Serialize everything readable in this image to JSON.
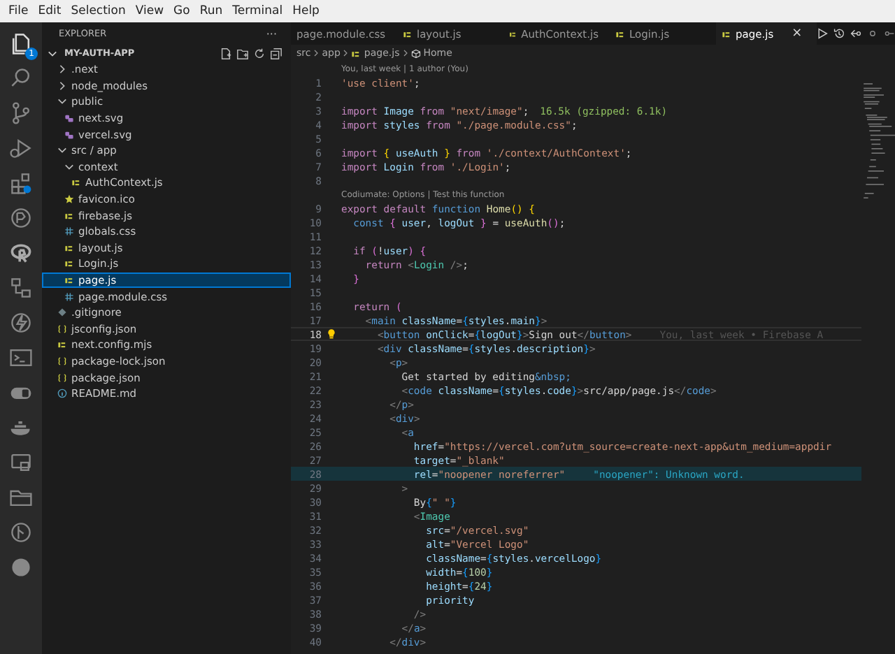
{
  "menu": [
    "File",
    "Edit",
    "Selection",
    "View",
    "Go",
    "Run",
    "Terminal",
    "Help"
  ],
  "activity_bar": {
    "explorer_badge": "1"
  },
  "explorer": {
    "title": "EXPLORER",
    "more": "···",
    "root": {
      "label": "MY-AUTH-APP",
      "expanded": true,
      "children": [
        {
          "label": ".next",
          "kind": "folder",
          "expanded": false,
          "selected": false
        },
        {
          "label": "node_modules",
          "kind": "folder",
          "expanded": false,
          "selected": false
        },
        {
          "label": "public",
          "kind": "folder",
          "expanded": true,
          "selected": false,
          "children": [
            {
              "label": "next.svg",
              "kind": "svg",
              "selected": false
            },
            {
              "label": "vercel.svg",
              "kind": "svg",
              "selected": false
            }
          ]
        },
        {
          "label": "src / app",
          "kind": "folder",
          "expanded": true,
          "selected": false,
          "children": [
            {
              "label": "context",
              "kind": "folder",
              "expanded": true,
              "selected": false,
              "children": [
                {
                  "label": "AuthContext.js",
                  "kind": "js",
                  "selected": false
                }
              ]
            },
            {
              "label": "favicon.ico",
              "kind": "ico",
              "selected": false
            },
            {
              "label": "firebase.js",
              "kind": "js",
              "selected": false
            },
            {
              "label": "globals.css",
              "kind": "css",
              "selected": false
            },
            {
              "label": "layout.js",
              "kind": "js",
              "selected": false
            },
            {
              "label": "Login.js",
              "kind": "js",
              "selected": false
            },
            {
              "label": "page.js",
              "kind": "js",
              "selected": true
            },
            {
              "label": "page.module.css",
              "kind": "css",
              "selected": false
            }
          ]
        },
        {
          "label": ".gitignore",
          "kind": "git",
          "selected": false
        },
        {
          "label": "jsconfig.json",
          "kind": "json",
          "selected": false
        },
        {
          "label": "next.config.mjs",
          "kind": "js",
          "selected": false
        },
        {
          "label": "package-lock.json",
          "kind": "json",
          "selected": false
        },
        {
          "label": "package.json",
          "kind": "json",
          "selected": false
        },
        {
          "label": "README.md",
          "kind": "md",
          "selected": false
        }
      ]
    }
  },
  "tabs": [
    {
      "label": "page.module.css",
      "kind": "plain",
      "selected": false
    },
    {
      "label": "layout.js",
      "kind": "js",
      "selected": false
    },
    {
      "label": "AuthContext.js",
      "kind": "js",
      "selected": false
    },
    {
      "label": "Login.js",
      "kind": "js",
      "selected": false
    },
    {
      "label": "page.js",
      "kind": "js",
      "selected": true,
      "close": "×"
    }
  ],
  "editor": {
    "breadcrumb": [
      "src",
      "app",
      "page.js",
      "Home"
    ],
    "lines": [
      {
        "number": "1",
        "lens": "You, last week | 1 author (You)",
        "current": false,
        "highlighted": false,
        "tokens": [
          {
            "kind": "st",
            "text": "'use client'"
          },
          {
            "kind": "pl",
            "text": ";"
          }
        ]
      },
      {
        "number": "2",
        "current": false,
        "highlighted": false
      },
      {
        "number": "3",
        "current": false,
        "highlighted": false,
        "tokens": [
          {
            "kind": "kw",
            "text": "import "
          },
          {
            "kind": "vr",
            "text": "Image "
          },
          {
            "kind": "kw",
            "text": "from "
          },
          {
            "kind": "st",
            "text": "\"next/image\""
          },
          {
            "kind": "pl",
            "text": ";"
          }
        ],
        "annotation": {
          "kind": "size",
          "text": "16.5k (gzipped: 6.1k)"
        }
      },
      {
        "number": "4",
        "current": false,
        "highlighted": false,
        "tokens": [
          {
            "kind": "kw",
            "text": "import "
          },
          {
            "kind": "vr",
            "text": "styles "
          },
          {
            "kind": "kw",
            "text": "from "
          },
          {
            "kind": "st",
            "text": "\"./page.module.css\""
          },
          {
            "kind": "pl",
            "text": ";"
          }
        ]
      },
      {
        "number": "5",
        "current": false,
        "highlighted": false
      },
      {
        "number": "6",
        "current": false,
        "highlighted": false,
        "tokens": [
          {
            "kind": "kw",
            "text": "import "
          },
          {
            "kind": "b1",
            "text": "{ "
          },
          {
            "kind": "vr",
            "text": "useAuth "
          },
          {
            "kind": "b1",
            "text": "} "
          },
          {
            "kind": "kw",
            "text": "from "
          },
          {
            "kind": "st",
            "text": "'./context/AuthContext'"
          },
          {
            "kind": "pl",
            "text": ";"
          }
        ]
      },
      {
        "number": "7",
        "current": false,
        "highlighted": false,
        "tokens": [
          {
            "kind": "kw",
            "text": "import "
          },
          {
            "kind": "vr",
            "text": "Login "
          },
          {
            "kind": "kw",
            "text": "from "
          },
          {
            "kind": "st",
            "text": "'./Login'"
          },
          {
            "kind": "pl",
            "text": ";"
          }
        ]
      },
      {
        "number": "8",
        "current": false,
        "highlighted": false
      },
      {
        "number": "9",
        "lens": "Codiumate: Options | Test this function",
        "current": false,
        "highlighted": false,
        "tokens": [
          {
            "kind": "kw",
            "text": "export default "
          },
          {
            "kind": "dc",
            "text": "function "
          },
          {
            "kind": "fn",
            "text": "Home"
          },
          {
            "kind": "b1",
            "text": "() {"
          }
        ]
      },
      {
        "number": "10",
        "current": false,
        "highlighted": false,
        "tokens": [
          {
            "kind": "dc",
            "text": "  const "
          },
          {
            "kind": "b2",
            "text": "{ "
          },
          {
            "kind": "vr",
            "text": "user"
          },
          {
            "kind": "pl",
            "text": ", "
          },
          {
            "kind": "vr",
            "text": "logOut "
          },
          {
            "kind": "b2",
            "text": "} "
          },
          {
            "kind": "pl",
            "text": "= "
          },
          {
            "kind": "fn",
            "text": "useAuth"
          },
          {
            "kind": "b2",
            "text": "()"
          },
          {
            "kind": "pl",
            "text": ";"
          }
        ]
      },
      {
        "number": "11",
        "current": false,
        "highlighted": false
      },
      {
        "number": "12",
        "current": false,
        "highlighted": false,
        "tokens": [
          {
            "kind": "kw",
            "text": "  if "
          },
          {
            "kind": "b2",
            "text": "("
          },
          {
            "kind": "pl",
            "text": "!"
          },
          {
            "kind": "vr",
            "text": "user"
          },
          {
            "kind": "b2",
            "text": ") {"
          }
        ]
      },
      {
        "number": "13",
        "current": false,
        "highlighted": false,
        "tokens": [
          {
            "kind": "kw",
            "text": "    return "
          },
          {
            "kind": "tg",
            "text": "<"
          },
          {
            "kind": "cp",
            "text": "Login"
          },
          {
            "kind": "tg",
            "text": " />"
          },
          {
            "kind": "pl",
            "text": ";"
          }
        ]
      },
      {
        "number": "14",
        "current": false,
        "highlighted": false,
        "tokens": [
          {
            "kind": "b2",
            "text": "  }"
          }
        ]
      },
      {
        "number": "15",
        "current": false,
        "highlighted": false
      },
      {
        "number": "16",
        "current": false,
        "highlighted": false,
        "tokens": [
          {
            "kind": "kw",
            "text": "  return "
          },
          {
            "kind": "b2",
            "text": "("
          }
        ]
      },
      {
        "number": "17",
        "current": false,
        "highlighted": false,
        "tokens": [
          {
            "kind": "tg",
            "text": "    <"
          },
          {
            "kind": "tn",
            "text": "main "
          },
          {
            "kind": "vr",
            "text": "className"
          },
          {
            "kind": "pl",
            "text": "="
          },
          {
            "kind": "b3",
            "text": "{"
          },
          {
            "kind": "vr",
            "text": "styles"
          },
          {
            "kind": "pl",
            "text": "."
          },
          {
            "kind": "vr",
            "text": "main"
          },
          {
            "kind": "b3",
            "text": "}"
          },
          {
            "kind": "tg",
            "text": ">"
          }
        ]
      },
      {
        "number": "18",
        "current": true,
        "highlighted": false,
        "tokens": [
          {
            "kind": "tg",
            "text": "      <"
          },
          {
            "kind": "tn",
            "text": "button "
          },
          {
            "kind": "vr",
            "text": "onClick"
          },
          {
            "kind": "pl",
            "text": "="
          },
          {
            "kind": "b3",
            "text": "{"
          },
          {
            "kind": "vr",
            "text": "logOut"
          },
          {
            "kind": "b3",
            "text": "}"
          },
          {
            "kind": "tg",
            "text": ">"
          },
          {
            "kind": "pl",
            "text": "Sign out"
          },
          {
            "kind": "tg",
            "text": "</"
          },
          {
            "kind": "tn",
            "text": "button"
          },
          {
            "kind": "tg",
            "text": ">"
          }
        ],
        "annotation": {
          "kind": "blame",
          "text": "You, last week • Firebase A"
        }
      },
      {
        "number": "19",
        "current": false,
        "highlighted": false,
        "tokens": [
          {
            "kind": "tg",
            "text": "      <"
          },
          {
            "kind": "tn",
            "text": "div "
          },
          {
            "kind": "vr",
            "text": "className"
          },
          {
            "kind": "pl",
            "text": "="
          },
          {
            "kind": "b3",
            "text": "{"
          },
          {
            "kind": "vr",
            "text": "styles"
          },
          {
            "kind": "pl",
            "text": "."
          },
          {
            "kind": "vr",
            "text": "description"
          },
          {
            "kind": "b3",
            "text": "}"
          },
          {
            "kind": "tg",
            "text": ">"
          }
        ]
      },
      {
        "number": "20",
        "current": false,
        "highlighted": false,
        "tokens": [
          {
            "kind": "tg",
            "text": "        <"
          },
          {
            "kind": "tn",
            "text": "p"
          },
          {
            "kind": "tg",
            "text": ">"
          }
        ]
      },
      {
        "number": "21",
        "current": false,
        "highlighted": false,
        "tokens": [
          {
            "kind": "pl",
            "text": "          Get started by editing"
          },
          {
            "kind": "dc",
            "text": "&nbsp;"
          }
        ]
      },
      {
        "number": "22",
        "current": false,
        "highlighted": false,
        "tokens": [
          {
            "kind": "tg",
            "text": "          <"
          },
          {
            "kind": "tn",
            "text": "code "
          },
          {
            "kind": "vr",
            "text": "className"
          },
          {
            "kind": "pl",
            "text": "="
          },
          {
            "kind": "b3",
            "text": "{"
          },
          {
            "kind": "vr",
            "text": "styles"
          },
          {
            "kind": "pl",
            "text": "."
          },
          {
            "kind": "vr",
            "text": "code"
          },
          {
            "kind": "b3",
            "text": "}"
          },
          {
            "kind": "tg",
            "text": ">"
          },
          {
            "kind": "pl",
            "text": "src/app/page.js"
          },
          {
            "kind": "tg",
            "text": "</"
          },
          {
            "kind": "tn",
            "text": "code"
          },
          {
            "kind": "tg",
            "text": ">"
          }
        ]
      },
      {
        "number": "23",
        "current": false,
        "highlighted": false,
        "tokens": [
          {
            "kind": "tg",
            "text": "        </"
          },
          {
            "kind": "tn",
            "text": "p"
          },
          {
            "kind": "tg",
            "text": ">"
          }
        ]
      },
      {
        "number": "24",
        "current": false,
        "highlighted": false,
        "tokens": [
          {
            "kind": "tg",
            "text": "        <"
          },
          {
            "kind": "tn",
            "text": "div"
          },
          {
            "kind": "tg",
            "text": ">"
          }
        ]
      },
      {
        "number": "25",
        "current": false,
        "highlighted": false,
        "tokens": [
          {
            "kind": "tg",
            "text": "          <"
          },
          {
            "kind": "tn",
            "text": "a"
          }
        ]
      },
      {
        "number": "26",
        "current": false,
        "highlighted": false,
        "tokens": [
          {
            "kind": "vr",
            "text": "            href"
          },
          {
            "kind": "pl",
            "text": "="
          },
          {
            "kind": "st",
            "text": "\"https://vercel.com?utm_source=create-next-app&utm_medium=appdir"
          }
        ]
      },
      {
        "number": "27",
        "current": false,
        "highlighted": false,
        "tokens": [
          {
            "kind": "vr",
            "text": "            target"
          },
          {
            "kind": "pl",
            "text": "="
          },
          {
            "kind": "st",
            "text": "\"_blank\""
          }
        ]
      },
      {
        "number": "28",
        "current": false,
        "highlighted": true,
        "tokens": [
          {
            "kind": "vr",
            "text": "            rel"
          },
          {
            "kind": "pl",
            "text": "="
          },
          {
            "kind": "st",
            "text": "\"noopener noreferrer\""
          }
        ],
        "annotation": {
          "kind": "diagnostic",
          "text": "\"noopener\": Unknown word."
        }
      },
      {
        "number": "29",
        "current": false,
        "highlighted": false,
        "tokens": [
          {
            "kind": "tg",
            "text": "          >"
          }
        ]
      },
      {
        "number": "30",
        "current": false,
        "highlighted": false,
        "tokens": [
          {
            "kind": "pl",
            "text": "            By"
          },
          {
            "kind": "b3",
            "text": "{"
          },
          {
            "kind": "st",
            "text": "\" \""
          },
          {
            "kind": "b3",
            "text": "}"
          }
        ]
      },
      {
        "number": "31",
        "current": false,
        "highlighted": false,
        "tokens": [
          {
            "kind": "tg",
            "text": "            <"
          },
          {
            "kind": "cp",
            "text": "Image"
          }
        ]
      },
      {
        "number": "32",
        "current": false,
        "highlighted": false,
        "tokens": [
          {
            "kind": "vr",
            "text": "              src"
          },
          {
            "kind": "pl",
            "text": "="
          },
          {
            "kind": "st",
            "text": "\"/vercel.svg\""
          }
        ]
      },
      {
        "number": "33",
        "current": false,
        "highlighted": false,
        "tokens": [
          {
            "kind": "vr",
            "text": "              alt"
          },
          {
            "kind": "pl",
            "text": "="
          },
          {
            "kind": "st",
            "text": "\"Vercel Logo\""
          }
        ]
      },
      {
        "number": "34",
        "current": false,
        "highlighted": false,
        "tokens": [
          {
            "kind": "vr",
            "text": "              className"
          },
          {
            "kind": "pl",
            "text": "="
          },
          {
            "kind": "b3",
            "text": "{"
          },
          {
            "kind": "vr",
            "text": "styles"
          },
          {
            "kind": "pl",
            "text": "."
          },
          {
            "kind": "vr",
            "text": "vercelLogo"
          },
          {
            "kind": "b3",
            "text": "}"
          }
        ]
      },
      {
        "number": "35",
        "current": false,
        "highlighted": false,
        "tokens": [
          {
            "kind": "vr",
            "text": "              width"
          },
          {
            "kind": "pl",
            "text": "="
          },
          {
            "kind": "b3",
            "text": "{"
          },
          {
            "kind": "nm",
            "text": "100"
          },
          {
            "kind": "b3",
            "text": "}"
          }
        ]
      },
      {
        "number": "36",
        "current": false,
        "highlighted": false,
        "tokens": [
          {
            "kind": "vr",
            "text": "              height"
          },
          {
            "kind": "pl",
            "text": "="
          },
          {
            "kind": "b3",
            "text": "{"
          },
          {
            "kind": "nm",
            "text": "24"
          },
          {
            "kind": "b3",
            "text": "}"
          }
        ]
      },
      {
        "number": "37",
        "current": false,
        "highlighted": false,
        "tokens": [
          {
            "kind": "vr",
            "text": "              priority"
          }
        ]
      },
      {
        "number": "38",
        "current": false,
        "highlighted": false,
        "tokens": [
          {
            "kind": "tg",
            "text": "            />"
          }
        ]
      },
      {
        "number": "39",
        "current": false,
        "highlighted": false,
        "tokens": [
          {
            "kind": "tg",
            "text": "          </"
          },
          {
            "kind": "tn",
            "text": "a"
          },
          {
            "kind": "tg",
            "text": ">"
          }
        ]
      },
      {
        "number": "40",
        "current": false,
        "highlighted": false,
        "tokens": [
          {
            "kind": "tg",
            "text": "        </"
          },
          {
            "kind": "tn",
            "text": "div"
          },
          {
            "kind": "tg",
            "text": ">"
          }
        ]
      }
    ]
  }
}
